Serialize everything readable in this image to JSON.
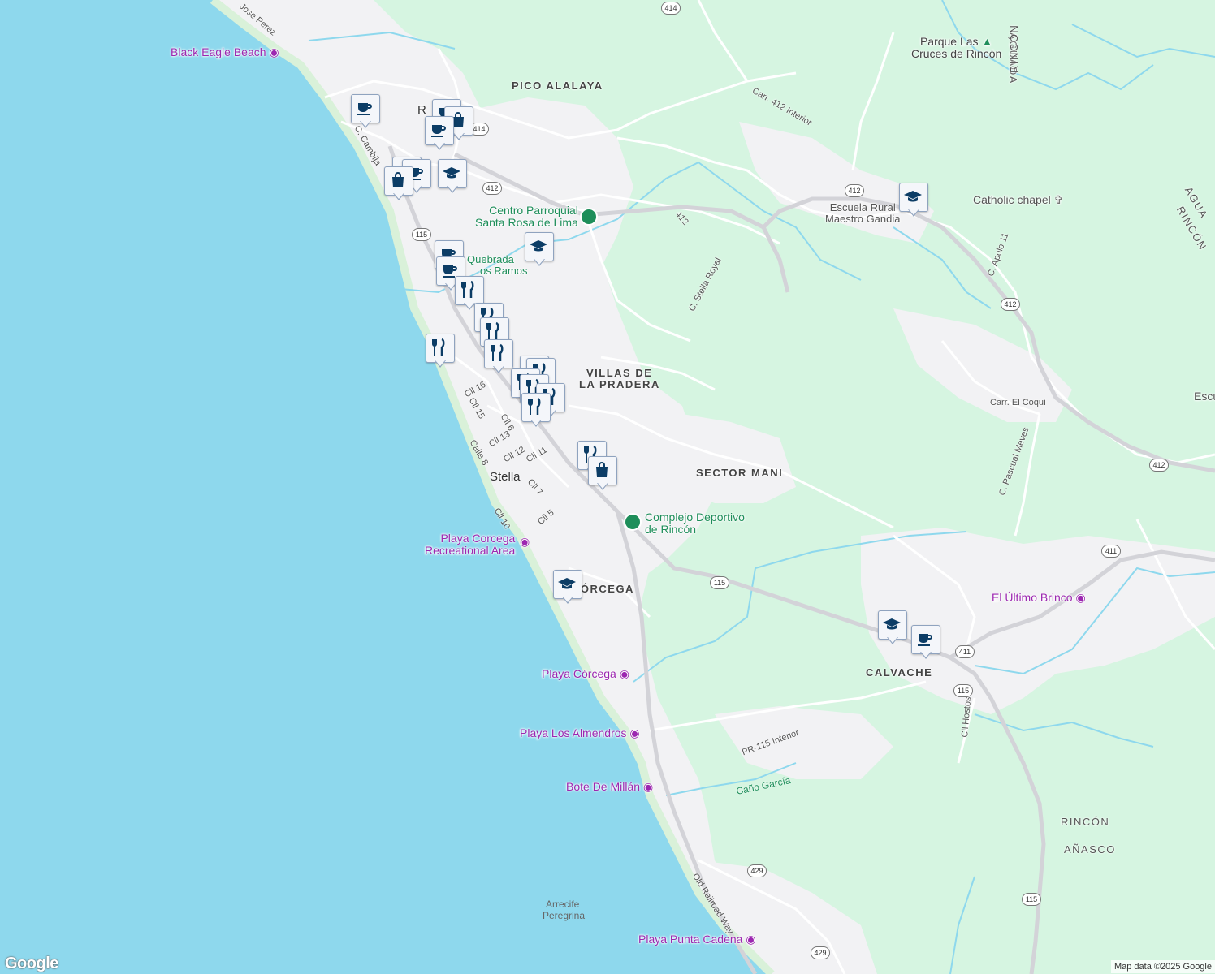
{
  "map": {
    "colors": {
      "ocean": "#8ed8ed",
      "land": "#f2f2f4",
      "vegetation": "#d6f5e1",
      "beach": "#d9f1d9",
      "road": "#ffffff",
      "highway": "#d3d3d8",
      "stream": "#8ed8ed",
      "marker_icon": "#0c3d66",
      "poi_purple": "#9c27b0",
      "poi_green": "#1e8e5a"
    },
    "poi_labels": [
      {
        "text": "Black Eagle Beach",
        "icon": "camera-icon",
        "color": "purple"
      },
      {
        "text": "Centro Parroquial",
        "text2": "Santa Rosa de Lima",
        "icon": "green-dot-icon",
        "color": "green"
      },
      {
        "text": "Playa Corcega",
        "text2": "Recreational Area",
        "icon": "camera-icon",
        "color": "purple"
      },
      {
        "text": "Complejo Deportivo",
        "text2": "de Rincón",
        "icon": "green-dot-icon",
        "color": "green"
      },
      {
        "text": "Playa Córcega",
        "icon": "camera-icon",
        "color": "purple"
      },
      {
        "text": "Playa Los Almendros",
        "icon": "camera-icon",
        "color": "purple"
      },
      {
        "text": "Bote De Millán",
        "icon": "camera-icon",
        "color": "purple"
      },
      {
        "text": "Playa Punta Cadena",
        "icon": "camera-icon",
        "color": "purple"
      },
      {
        "text": "El Último Brinco",
        "icon": "camera-icon",
        "color": "purple"
      },
      {
        "text": "Parque Las",
        "text2": "Cruces de Rincón",
        "icon": "tree-icon",
        "color": "green"
      },
      {
        "text": "Catholic chapel",
        "icon": "cross-icon",
        "color": "gray"
      },
      {
        "text": "Escuela Rural",
        "text2": "Maestro Gandia",
        "icon": "none",
        "color": "gray"
      },
      {
        "text": "Quebrada",
        "text2": "os Ramos",
        "icon": "none",
        "color": "green"
      }
    ],
    "area_labels": [
      "PICO ALALAYA",
      "VILLAS DE",
      "LA PRADERA",
      "SECTOR MANI",
      "CÓRCEGA",
      "CALVACHE",
      "RINCÓN",
      "AÑASCO",
      "AGUADA",
      "RINCÓN",
      "AGUA",
      "RINCÓN"
    ],
    "place_labels": [
      "Stella",
      "Arrecife",
      "Peregrina",
      "Escu",
      "R",
      "Caño García"
    ],
    "road_labels": [
      "Jose Perez",
      "C. Cambija",
      "Carr. 412 Interior",
      "C. Stella Royal",
      "C. Apolo 11",
      "Carr. El Coquí",
      "C. Pascual Meves",
      "Cll 16",
      "Cll 15",
      "Cll 6",
      "Cll 13",
      "Cll 12",
      "Cll 11",
      "Calle 8",
      "Cll 7",
      "Cll 10",
      "Cll 5",
      "PR-115 Interior",
      "Cll Hostos",
      "Old Railroad Way",
      "412"
    ],
    "route_shields": [
      "414",
      "414",
      "412",
      "412",
      "115",
      "412",
      "412",
      "115",
      "411",
      "411",
      "115",
      "115",
      "429",
      "429"
    ],
    "markers": [
      "coffee-cup-icon",
      "coffee-cup-icon",
      "shopping-bag-icon",
      "coffee-cup-icon",
      "coffee-cup-icon",
      "coffee-cup-icon",
      "shopping-bag-icon",
      "graduation-cap-icon",
      "coffee-cup-icon",
      "coffee-cup-icon",
      "graduation-cap-icon",
      "restaurant-icon",
      "restaurant-icon",
      "restaurant-icon",
      "restaurant-icon",
      "restaurant-icon",
      "restaurant-icon",
      "restaurant-icon",
      "restaurant-icon",
      "restaurant-icon",
      "restaurant-icon",
      "restaurant-icon",
      "restaurant-icon",
      "shopping-bag-icon",
      "graduation-cap-icon",
      "graduation-cap-icon",
      "coffee-cup-icon",
      "graduation-cap-icon"
    ],
    "google_logo": "Google",
    "attribution": "Map data ©2025 Google"
  }
}
